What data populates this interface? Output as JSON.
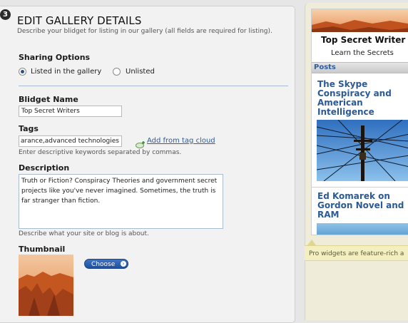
{
  "form": {
    "step_number": "3",
    "section_title": "EDIT GALLERY DETAILS",
    "section_description": "Describe your blidget for listing in our gallery (all fields are required for listing).",
    "sharing": {
      "heading": "Sharing Options",
      "options": [
        "Listed in the gallery",
        "Unlisted"
      ],
      "selected": "Listed in the gallery"
    },
    "name": {
      "heading": "Blidget Name",
      "value": "Top Secret Writers"
    },
    "tags": {
      "heading": "Tags",
      "value": "arance,advanced technologies",
      "add_link": "Add from tag cloud",
      "hint": "Enter descriptive keywords separated by commas."
    },
    "description": {
      "heading": "Description",
      "value": "Truth or Fiction? Conspiracy Theories and government secret projects like you've never imagined. Sometimes, the truth is far stranger than fiction.",
      "hint": "Describe what your site or blog is about."
    },
    "thumbnail": {
      "heading": "Thumbnail",
      "choose_label": "Choose"
    }
  },
  "preview": {
    "title": "Top Secret Writer",
    "subtitle": "Learn the Secrets",
    "posts_tab": "Posts",
    "posts": [
      {
        "title": "The Skype Conspiracy and American Intelligence"
      },
      {
        "title": "Ed Komarek on Gordon Novel and RAM"
      }
    ],
    "pro_tip": "Pro widgets are feature-rich a"
  },
  "colors": {
    "link": "#2b5aa0",
    "post_title": "#2b5a96",
    "button": "#1d4f9f",
    "tip_background": "#f4efc0"
  }
}
